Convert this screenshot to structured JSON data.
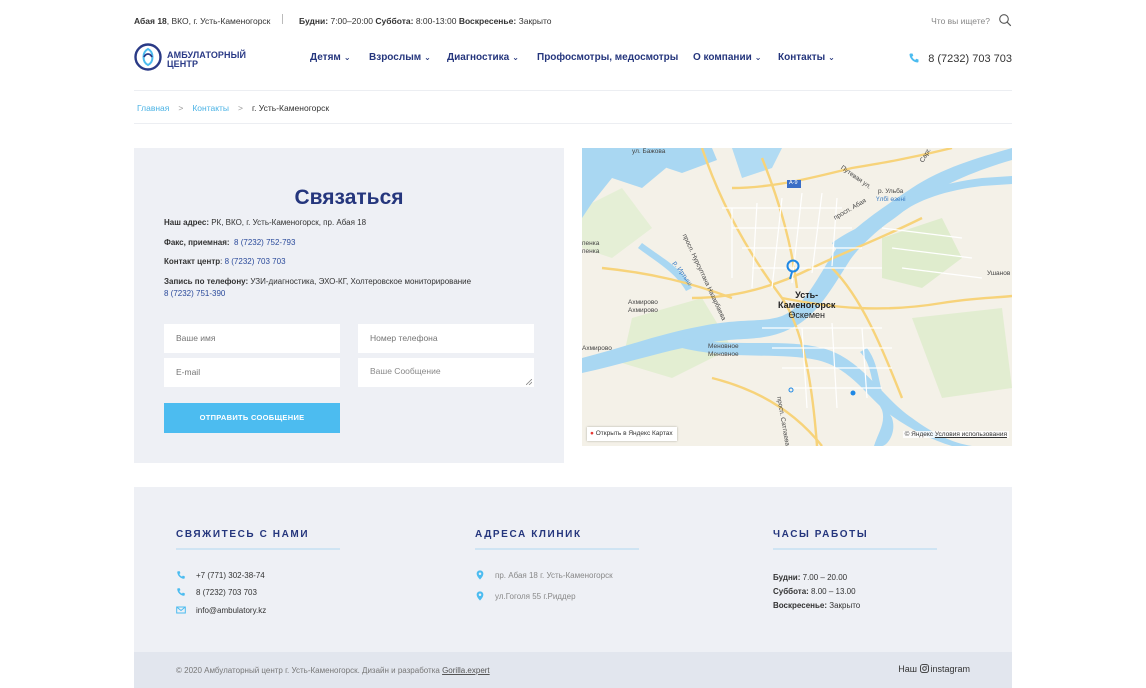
{
  "topbar": {
    "address_bold": "Абая 18",
    "address_rest": ", ВКО, г. Усть-Каменогорск",
    "weekdays_label": "Будни:",
    "weekdays_value": " 7:00–20:00 ",
    "saturday_label": "Суббота:",
    "saturday_value": " 8:00-13:00 ",
    "sunday_label": "Воскресенье:",
    "sunday_value": " Закрыто",
    "search_label": "Что вы ищете?"
  },
  "logo": {
    "line1": "АМБУЛАТОРНЫЙ",
    "line2": "ЦЕНТР"
  },
  "nav": {
    "items": [
      {
        "label": "Детям",
        "chev": "⌄"
      },
      {
        "label": "Взрослым",
        "chev": "⌄"
      },
      {
        "label": "Диагностика",
        "chev": "⌄"
      },
      {
        "label": "Профосмотры, медосмотры",
        "chev": ""
      },
      {
        "label": "О компании",
        "chev": "⌄"
      },
      {
        "label": "Контакты",
        "chev": "⌄"
      }
    ]
  },
  "header": {
    "phone": "8 (7232) 703 703"
  },
  "breadcrumb": {
    "home": "Главная",
    "contacts": "Контакты",
    "current": "г. Усть-Каменогорск",
    "sep": ">"
  },
  "contact": {
    "title": "Связаться",
    "address_label": "Наш адрес:",
    "address_value": " РК, ВКО, г. Усть-Каменогорск, пр. Абая 18",
    "fax_label": "Факс, приемная:",
    "fax_value": "8 (7232) 752-793",
    "center_label": "Контакт центр",
    "center_value": "8 (7232) 703 703",
    "booking_label": "Запись по телефону:",
    "booking_desc": " УЗИ-диагностика, ЭХО-КГ, Холтеровское мониторирование",
    "booking_phone": "8 (7232) 751-390",
    "name_placeholder": "Ваше имя",
    "phone_placeholder": "Номер телефона",
    "email_placeholder": "E-mail",
    "message_placeholder": "Ваше Сообщение",
    "submit": "ОТПРАВИТЬ СООБЩЕНИЕ"
  },
  "map": {
    "open_label": "Открыть в Яндекс Картах",
    "copyright": "© Яндекс ",
    "terms": "Условия использования",
    "city_line1": "Усть-",
    "city_line2": "Каменогорск",
    "city_line3": "Өскемен",
    "labels": {
      "bazhova": "ул. Бажова",
      "ulba": "р. Ульба",
      "ulba2": "Үлбі өзені",
      "abaya": "просп. Абая",
      "putevaya": "Путевая ул.",
      "a9": "А-9",
      "ushanov": "Ушанов",
      "ahmirovo1": "Ахмирово",
      "ahmirovo2": "Ахмирово",
      "ahmirovo3": "Ахмирово",
      "menovnoe1": "Меновное",
      "menovnoe2": "Меновное",
      "lenka1": "пенка",
      "lenka2": "пенка",
      "nazarbaeva": "просп. Нурсултана Назарбаева",
      "satpaeva": "просп. Сатпаева",
      "irtysh": "р. Иртыш",
      "sarg": "Сарг."
    }
  },
  "footer": {
    "contacts_head": "СВЯЖИТЕСЬ С НАМИ",
    "contacts": [
      {
        "icon": "phone-icon",
        "text": "+7 (771) 302-38-74"
      },
      {
        "icon": "phone-icon",
        "text": "8 (7232) 703 703"
      },
      {
        "icon": "mail-icon",
        "text": "info@ambulatory.kz"
      }
    ],
    "clinics_head": "АДРЕСА КЛИНИК",
    "clinics": [
      {
        "icon": "location-pin-icon",
        "text": "пр. Абая 18 г. Усть-Каменогорск"
      },
      {
        "icon": "location-pin-icon",
        "text": "ул.Гоголя 55 г.Риддер"
      }
    ],
    "hours_head": "ЧАСЫ РАБОТЫ",
    "hours": [
      {
        "label": "Будни:",
        "value": " 7.00 – 20.00"
      },
      {
        "label": "Суббота:",
        "value": " 8.00 – 13.00"
      },
      {
        "label": "Воскресенье:",
        "value": " Закрыто"
      }
    ],
    "copyright": "© 2020 Амбулаторный центр г. Усть-Каменогорск. Дизайн и разработка ",
    "dev_link": "Gorilla.expert",
    "insta_prefix": "Наш ",
    "insta_label": "instagram"
  },
  "colors": {
    "brand": "#25367d",
    "accent": "#4cbcf0",
    "panel": "#eef0f5"
  }
}
